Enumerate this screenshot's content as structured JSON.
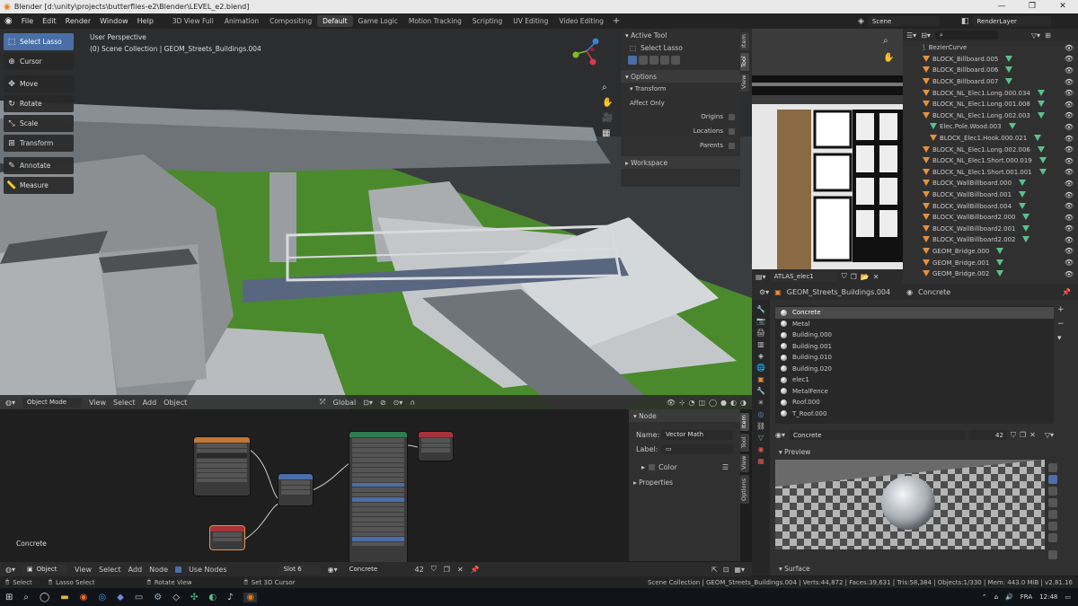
{
  "window": {
    "title": "Blender [d:\\unity\\projects\\butterflies-e2\\Blender\\LEVEL_e2.blend]",
    "controls": [
      "—",
      "❐",
      "✕"
    ]
  },
  "menu": [
    "File",
    "Edit",
    "Render",
    "Window",
    "Help"
  ],
  "workspaces": [
    "3D View Full",
    "Animation",
    "Compositing",
    "Default",
    "Game Logic",
    "Motion Tracking",
    "Scripting",
    "UV Editing",
    "Video Editing"
  ],
  "active_workspace": "Default",
  "scene": {
    "label": "Scene",
    "render_layer": "RenderLayer"
  },
  "viewport": {
    "perspective": "User Perspective",
    "collection": "(0) Scene Collection | GEOM_Streets_Buildings.004",
    "header": {
      "mode": "Object Mode",
      "menus": [
        "View",
        "Select",
        "Add",
        "Object"
      ],
      "orientation": "Global"
    }
  },
  "tools": [
    "Select Lasso",
    "Cursor",
    "Move",
    "Rotate",
    "Scale",
    "Transform",
    "Annotate",
    "Measure"
  ],
  "tool_panel": {
    "active_tool_title": "Active Tool",
    "active_tool": "Select Lasso",
    "options_title": "Options",
    "transform_title": "Transform",
    "affect_only": "Affect Only",
    "checkboxes": [
      "Origins",
      "Locations",
      "Parents"
    ],
    "workspace_title": "Workspace",
    "tabs": [
      "Item",
      "Tool",
      "View"
    ]
  },
  "image_editor": {
    "image_name": "ATLAS_elec1"
  },
  "outliner": {
    "items": [
      {
        "name": "BezierCurve",
        "kind": "curve"
      },
      {
        "name": "BLOCK_Billboard.005",
        "kind": "mesh"
      },
      {
        "name": "BLOCK_Billboard.006",
        "kind": "mesh"
      },
      {
        "name": "BLOCK_Billboard.007",
        "kind": "mesh"
      },
      {
        "name": "BLOCK_NL_Elec1.Long.000.034",
        "kind": "mesh"
      },
      {
        "name": "BLOCK_NL_Elec1.Long.001.008",
        "kind": "mesh"
      },
      {
        "name": "BLOCK_NL_Elec1.Long.002.003",
        "kind": "mesh"
      },
      {
        "name": "Elec.Pole.Wood.003",
        "kind": "sub"
      },
      {
        "name": "BLOCK_Elec1.Hook.000.021",
        "kind": "sub"
      },
      {
        "name": "BLOCK_NL_Elec1.Long.002.006",
        "kind": "mesh"
      },
      {
        "name": "BLOCK_NL_Elec1.Short.000.019",
        "kind": "mesh"
      },
      {
        "name": "BLOCK_NL_Elec1.Short.001.001",
        "kind": "mesh"
      },
      {
        "name": "BLOCK_WallBillboard.000",
        "kind": "mesh"
      },
      {
        "name": "BLOCK_WallBillboard.001",
        "kind": "mesh"
      },
      {
        "name": "BLOCK_WallBillboard.004",
        "kind": "mesh"
      },
      {
        "name": "BLOCK_WallBillboard2.000",
        "kind": "mesh"
      },
      {
        "name": "BLOCK_WallBillboard2.001",
        "kind": "mesh"
      },
      {
        "name": "BLOCK_WallBillboard2.002",
        "kind": "mesh"
      },
      {
        "name": "GEOM_Bridge.000",
        "kind": "mesh"
      },
      {
        "name": "GEOM_Bridge.001",
        "kind": "mesh"
      },
      {
        "name": "GEOM_Bridge.002",
        "kind": "mesh"
      }
    ]
  },
  "properties": {
    "object": "GEOM_Streets_Buildings.004",
    "material": "Concrete",
    "materials": [
      "Concrete",
      "Metal",
      "Building.000",
      "Building.001",
      "Building.010",
      "Building.020",
      "elec1",
      "MetalFence",
      "Roof.000",
      "T_Roof.000"
    ],
    "slot_name": "Concrete",
    "user_count": "42",
    "preview_title": "Preview",
    "surface_title": "Surface"
  },
  "node_editor": {
    "label": "Concrete",
    "header": {
      "object_menu": "Object",
      "menus": [
        "View",
        "Select",
        "Add",
        "Node"
      ],
      "use_nodes": "Use Nodes",
      "slot": "Slot 6",
      "material": "Concrete",
      "users": "42"
    },
    "sidebar": {
      "node_title": "Node",
      "name_label": "Name:",
      "name_value": "Vector Math",
      "label_label": "Label:",
      "color_label": "Color",
      "properties_title": "Properties",
      "tabs": [
        "Item",
        "Tool",
        "View",
        "Options"
      ]
    }
  },
  "status": {
    "left": [
      "Select",
      "Lasso Select",
      "Rotate View",
      "Set 3D Cursor"
    ],
    "right": "Scene Collection | GEOM_Streets_Buildings.004 | Verts:44,872 | Faces:39,631 | Tris:58,384 | Objects:1/330 | Mem: 443.0 MiB | v2.81.16"
  },
  "taskbar": {
    "lang": "FRA",
    "time": "12:48"
  }
}
